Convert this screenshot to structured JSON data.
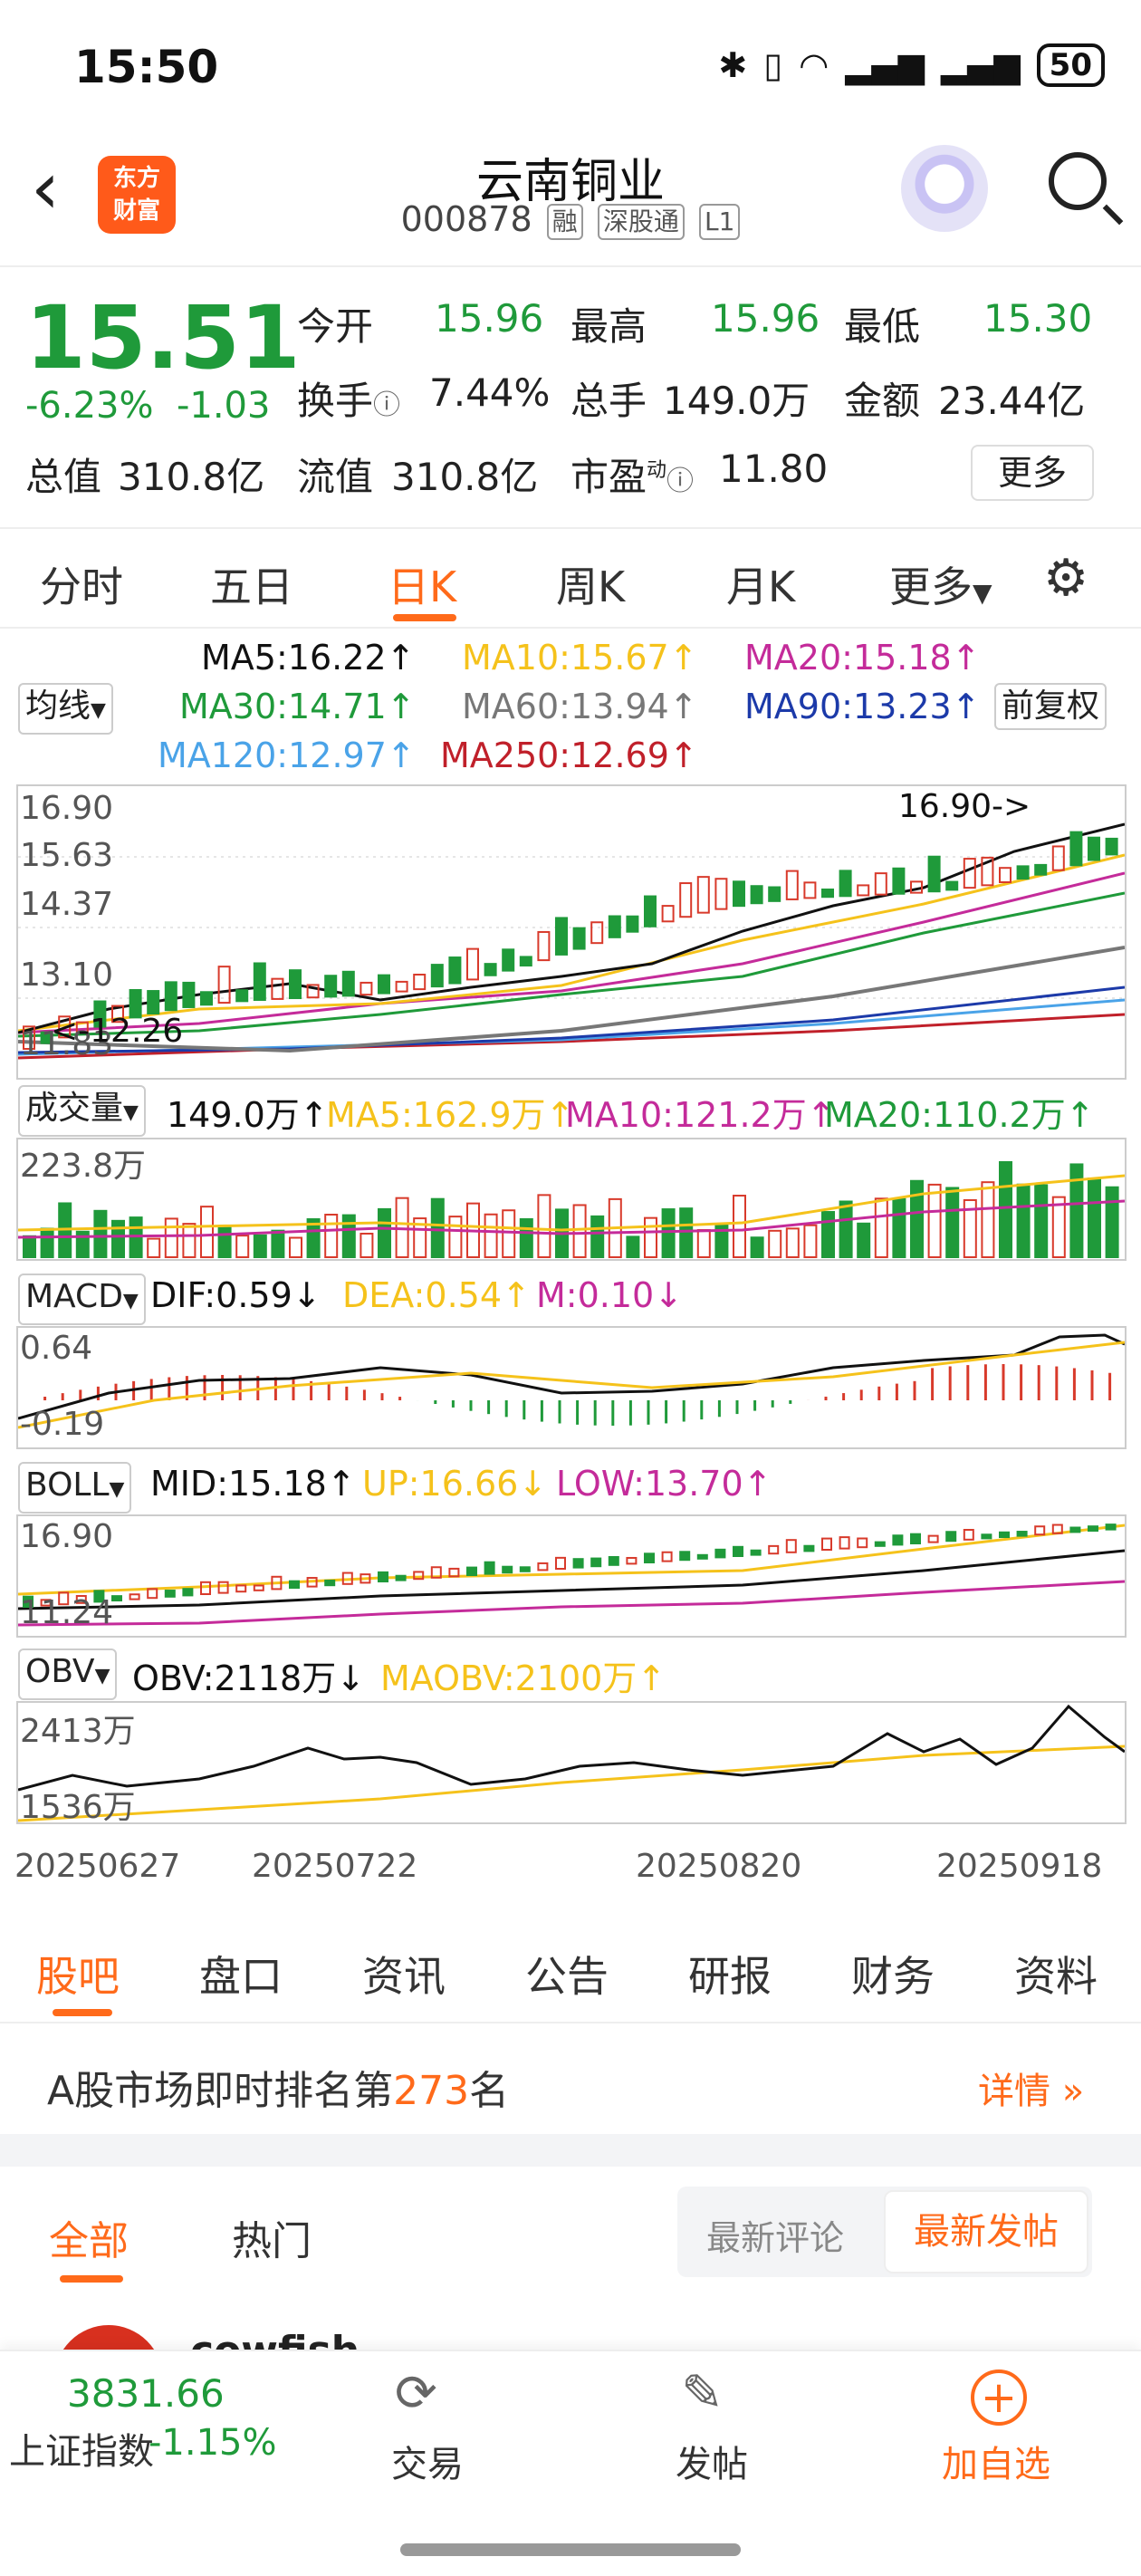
{
  "status": {
    "time": "15:50",
    "battery": "50"
  },
  "header": {
    "title": "云南铜业",
    "code": "000878",
    "tags": [
      "融",
      "深股通",
      "L1"
    ],
    "logo_line1": "东方",
    "logo_line2": "财富"
  },
  "quote": {
    "price": "15.51",
    "change_pct": "-6.23%",
    "change": "-1.03",
    "open_label": "今开",
    "open": "15.96",
    "high_label": "最高",
    "high": "15.96",
    "low_label": "最低",
    "low": "15.30",
    "turnover_label": "换手",
    "turnover": "7.44%",
    "volume_label": "总手",
    "volume": "149.0万",
    "amount_label": "金额",
    "amount": "23.44亿",
    "mktcap_label": "总值",
    "mktcap": "310.8亿",
    "float_label": "流值",
    "float": "310.8亿",
    "pe_label": "市盈",
    "pe_sup": "动",
    "pe": "11.80",
    "more": "更多"
  },
  "tabs": [
    "分时",
    "五日",
    "日K",
    "周K",
    "月K",
    "更多"
  ],
  "active_tab": "日K",
  "ma": {
    "selector": "均线",
    "fq": "前复权",
    "ma5": "MA5:16.22↑",
    "ma10": "MA10:15.67↑",
    "ma20": "MA20:15.18↑",
    "ma30": "MA30:14.71↑",
    "ma60": "MA60:13.94↑",
    "ma90": "MA90:13.23↑",
    "ma120": "MA120:12.97↑",
    "ma250": "MA250:12.69↑"
  },
  "kline": {
    "yticks": [
      "16.90",
      "15.63",
      "14.37",
      "13.10",
      "11.83"
    ],
    "high_mark": "16.90->",
    "low_mark": "<-12.26"
  },
  "volume": {
    "selector": "成交量",
    "vol": "149.0万↑",
    "ma5": "MA5:162.9万↑",
    "ma10": "MA10:121.2万↑",
    "ma20": "MA20:110.2万↑",
    "ytick": "223.8万"
  },
  "macd": {
    "selector": "MACD",
    "dif": "DIF:0.59↓",
    "dea": "DEA:0.54↑",
    "m": "M:0.10↓",
    "ytick_top": "0.64",
    "ytick_bottom": "-0.19"
  },
  "boll": {
    "selector": "BOLL",
    "mid": "MID:15.18↑",
    "up": "UP:16.66↓",
    "low": "LOW:13.70↑",
    "ytick_top": "16.90",
    "ytick_bottom": "11.24"
  },
  "obv": {
    "selector": "OBV",
    "obv": "OBV:2118万↓",
    "maobv": "MAOBV:2100万↑",
    "ytick_top": "2413万",
    "ytick_bottom": "1536万"
  },
  "dates": [
    "20250627",
    "20250722",
    "20250820",
    "20250918"
  ],
  "bottom_tabs": [
    "股吧",
    "盘口",
    "资讯",
    "公告",
    "研报",
    "财务",
    "资料"
  ],
  "rank": {
    "prefix": "A股市场即时排名第",
    "num": "273",
    "suffix": "名",
    "detail": "详情"
  },
  "filter": {
    "all": "全部",
    "hot": "热门",
    "latest_comment": "最新评论",
    "latest_post": "最新发帖"
  },
  "post_preview": "cowfish",
  "footer": {
    "index_value": "3831.66",
    "index_name": "上证指数",
    "index_change": "-1.15%",
    "trade": "交易",
    "post": "发帖",
    "add": "加自选"
  },
  "colors": {
    "up": "#d83a2b",
    "down": "#1f9a3a",
    "accent": "#ff6a1a",
    "ma5": "#111111",
    "ma10": "#f5c21b",
    "ma20": "#c42b9a",
    "ma30": "#1f9a3a",
    "ma60": "#777777",
    "ma90": "#1c3aa9",
    "ma120": "#4aa3e8",
    "ma250": "#c0202a"
  }
}
